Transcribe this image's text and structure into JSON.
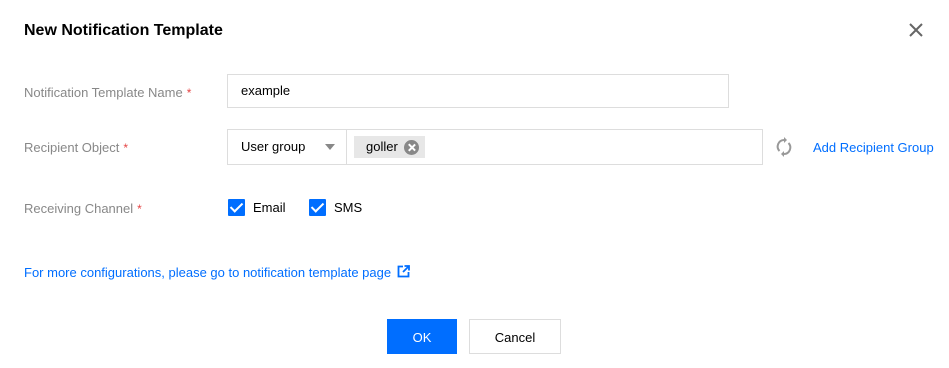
{
  "dialog": {
    "title": "New Notification Template",
    "close_icon": "close-icon"
  },
  "form": {
    "template_name": {
      "label": "Notification Template Name",
      "required_mark": "*",
      "value": "example"
    },
    "recipient_object": {
      "label": "Recipient Object",
      "required_mark": "*",
      "type_selected": "User group",
      "tags": [
        "goller"
      ],
      "refresh_icon": "refresh-icon",
      "add_link": "Add Recipient Group"
    },
    "receiving_channel": {
      "label": "Receiving Channel",
      "required_mark": "*",
      "options": [
        {
          "label": "Email",
          "checked": true
        },
        {
          "label": "SMS",
          "checked": true
        }
      ]
    }
  },
  "more_config_link": "For more configurations, please go to notification template page",
  "external_link_icon": "external-link-icon",
  "footer": {
    "ok_label": "OK",
    "cancel_label": "Cancel"
  },
  "colors": {
    "primary": "#006eff",
    "required": "#e54545",
    "label": "#888888",
    "border": "#dddddd",
    "tag_bg": "#e7e7e7"
  }
}
